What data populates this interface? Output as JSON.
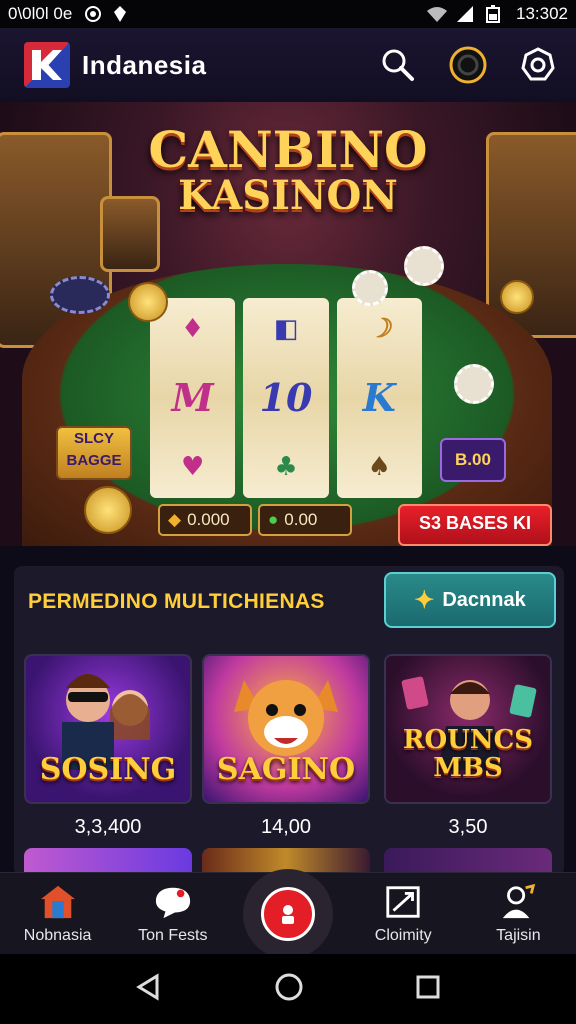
{
  "status_bar": {
    "left_text": "0\\0l0l 0e",
    "time": "13:302"
  },
  "header": {
    "brand": "Indanesia",
    "icons": [
      "search-icon",
      "coin-icon",
      "settings-icon"
    ]
  },
  "hero": {
    "title_line1": "CANBINO",
    "title_line2": "KASINON",
    "reels": [
      [
        "♦",
        "M",
        "♥"
      ],
      [
        "◧",
        "10",
        "♣"
      ],
      [
        "☽",
        "K",
        "♠"
      ]
    ],
    "slot_badge": "SLCY\nBAGGE",
    "bet_badge": "B.00",
    "counter1": "0.000",
    "counter2": "0.00",
    "cta": "S3 BASES KI"
  },
  "section": {
    "title": "PERMEDINO MULTICHIENAS",
    "button_label": "Dacnnak",
    "cards": [
      {
        "title": "SOSING",
        "value": "3,3,400"
      },
      {
        "title": "SAGINO",
        "value": "14,00"
      },
      {
        "title": "ROUNCS MBS",
        "value": "3,50"
      }
    ]
  },
  "bottom_nav": [
    {
      "label": "Nobnasia",
      "icon": "home-icon"
    },
    {
      "label": "Ton Fests",
      "icon": "chat-bubble-icon"
    },
    {
      "label": "",
      "icon": "chip-icon"
    },
    {
      "label": "Cloimity",
      "icon": "share-icon"
    },
    {
      "label": "Tajisin",
      "icon": "user-icon"
    }
  ],
  "colors": {
    "accent": "#ffce3a",
    "primary_red": "#e41e26",
    "teal": "#1a6a6e",
    "background": "#0d0b17"
  }
}
